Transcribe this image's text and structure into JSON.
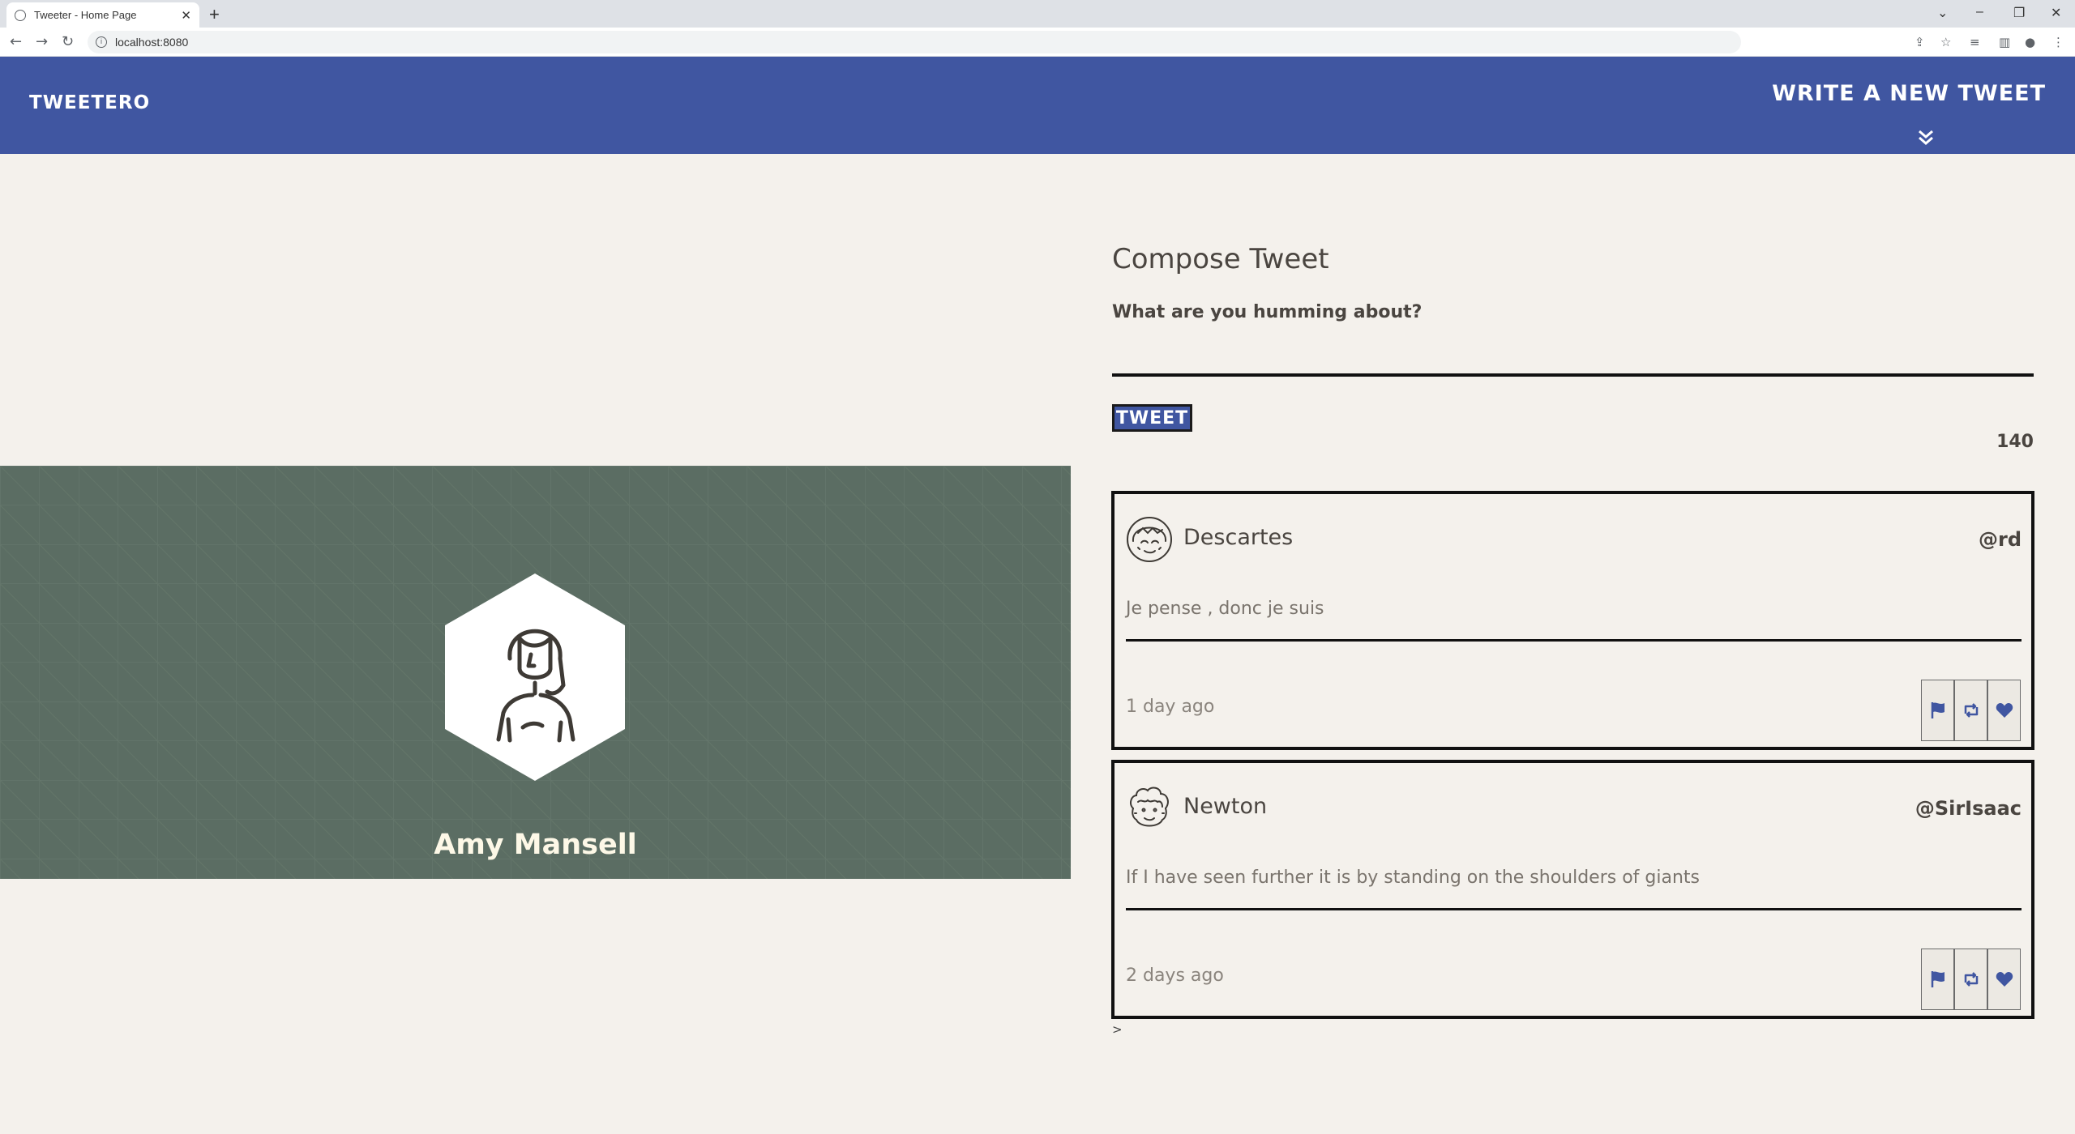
{
  "browser": {
    "tab_title": "Tweeter - Home Page",
    "tab_close": "✕",
    "new_tab": "+",
    "url": "localhost:8080"
  },
  "header": {
    "brand": "TWEETERO",
    "write_tweet": "WRITE A NEW TWEET"
  },
  "profile": {
    "name": "Amy Mansell",
    "background_color": "#5b6d63"
  },
  "compose": {
    "title": "Compose Tweet",
    "prompt": "What are you humming about?",
    "input_value": "",
    "button_label": "TWEET",
    "char_counter": "140"
  },
  "tweets": [
    {
      "name": "Descartes",
      "handle": "@rd",
      "body": "Je pense , donc je suis",
      "time": "1 day ago",
      "avatar": "girl-face-icon"
    },
    {
      "name": "Newton",
      "handle": "@SirIsaac",
      "body": "If I have seen further it is by standing on the shoulders of giants",
      "time": "2 days ago",
      "avatar": "curly-hair-face-icon"
    }
  ],
  "stray_text": ">",
  "colors": {
    "nav": "#4056a1",
    "page_bg": "#f4f1ec",
    "profile_bg": "#5b6d63",
    "name_text": "#fdf8e7"
  }
}
